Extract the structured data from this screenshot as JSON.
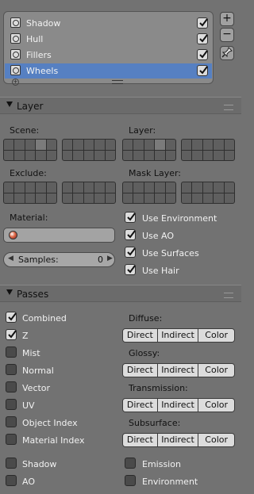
{
  "render_layers": {
    "items": [
      {
        "label": "Shadow",
        "checked": true,
        "selected": false
      },
      {
        "label": "Hull",
        "checked": true,
        "selected": false
      },
      {
        "label": "Fillers",
        "checked": true,
        "selected": false
      },
      {
        "label": "Wheels",
        "checked": true,
        "selected": true
      }
    ],
    "side_buttons": {
      "add": "+",
      "remove": "−"
    }
  },
  "layer_panel": {
    "title": "Layer",
    "scene_label": "Scene:",
    "layer_label": "Layer:",
    "exclude_label": "Exclude:",
    "mask_layer_label": "Mask Layer:",
    "material_label": "Material:",
    "samples_label": "Samples:",
    "samples_value": "0",
    "use_environment": "Use Environment",
    "use_ao": "Use AO",
    "use_surfaces": "Use Surfaces",
    "use_hair": "Use Hair"
  },
  "passes_panel": {
    "title": "Passes",
    "combined": "Combined",
    "z": "Z",
    "mist": "Mist",
    "normal": "Normal",
    "vector": "Vector",
    "uv": "UV",
    "object_index": "Object Index",
    "material_index": "Material Index",
    "shadow": "Shadow",
    "ao": "AO",
    "emission": "Emission",
    "environment": "Environment",
    "diffuse": "Diffuse:",
    "glossy": "Glossy:",
    "transmission": "Transmission:",
    "subsurface": "Subsurface:",
    "direct": "Direct",
    "indirect": "Indirect",
    "color": "Color"
  }
}
